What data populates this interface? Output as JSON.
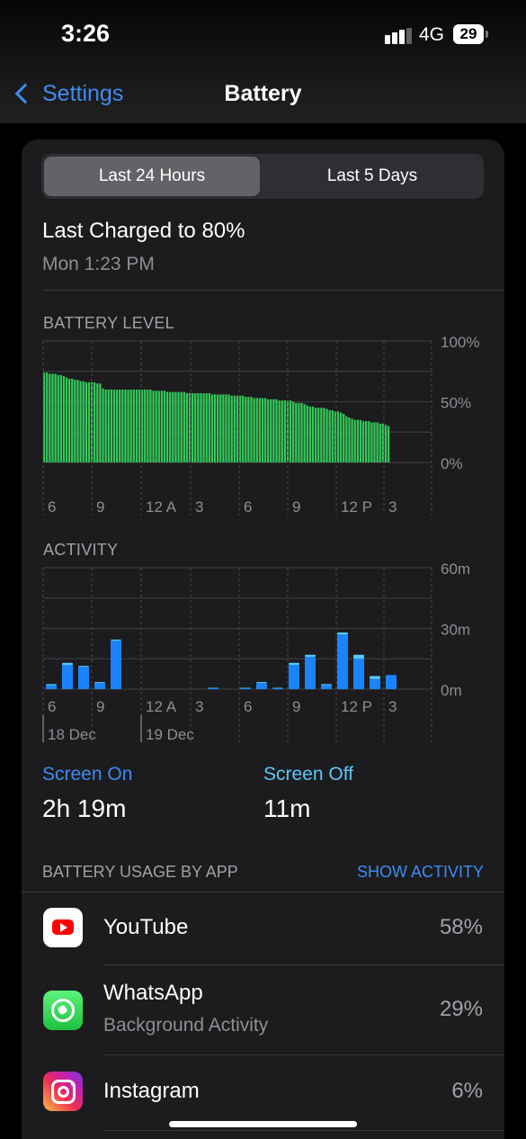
{
  "status_bar": {
    "time": "3:26",
    "network": "4G",
    "battery_percent": "29"
  },
  "nav": {
    "back_label": "Settings",
    "title": "Battery"
  },
  "segmented": {
    "options": [
      "Last 24 Hours",
      "Last 5 Days"
    ],
    "selected": "Last 24 Hours"
  },
  "last_charged": {
    "title": "Last Charged to 80%",
    "time": "Mon 1:23 PM"
  },
  "battery_level_label": "BATTERY LEVEL",
  "activity_label": "ACTIVITY",
  "chart_data": [
    {
      "type": "bar",
      "title": "BATTERY LEVEL",
      "color": "#34c759",
      "y_ticks": [
        "100%",
        "50%",
        "0%"
      ],
      "ylim": [
        0,
        100
      ],
      "x_ticks": [
        "6",
        "9",
        "12 A",
        "3",
        "6",
        "9",
        "12 P",
        "3"
      ],
      "values": [
        74,
        74,
        73,
        73,
        73,
        72,
        72,
        71,
        70,
        69,
        69,
        68,
        68,
        67,
        67,
        66,
        66,
        66,
        66,
        65,
        65,
        61,
        60,
        60,
        60,
        60,
        60,
        60,
        60,
        60,
        60,
        60,
        60,
        60,
        60,
        60,
        60,
        60,
        60,
        59,
        59,
        59,
        59,
        59,
        58,
        58,
        58,
        58,
        58,
        58,
        58,
        57,
        57,
        57,
        57,
        57,
        57,
        57,
        57,
        57,
        56,
        56,
        56,
        56,
        56,
        56,
        56,
        55,
        55,
        55,
        55,
        55,
        54,
        54,
        54,
        53,
        53,
        53,
        53,
        53,
        52,
        52,
        52,
        52,
        51,
        51,
        51,
        51,
        51,
        50,
        49,
        49,
        49,
        48,
        47,
        46,
        46,
        45,
        45,
        45,
        45,
        44,
        43,
        43,
        42,
        42,
        41,
        40,
        38,
        37,
        36,
        35,
        35,
        35,
        34,
        34,
        34,
        33,
        33,
        33,
        32,
        32,
        31,
        30
      ]
    },
    {
      "type": "bar",
      "title": "ACTIVITY",
      "y_ticks": [
        "60m",
        "30m",
        "0m"
      ],
      "ylim": [
        0,
        60
      ],
      "x_ticks": [
        "6",
        "9",
        "12 A",
        "3",
        "6",
        "9",
        "12 P",
        "3"
      ],
      "dates": [
        "18 Dec",
        "19 Dec"
      ],
      "hours": [
        "5",
        "6",
        "7",
        "8",
        "9",
        "10",
        "11",
        "12 A",
        "1",
        "2",
        "3",
        "4",
        "5",
        "6",
        "7",
        "8",
        "9",
        "10",
        "11",
        "12 P",
        "1",
        "2",
        "3"
      ],
      "series": [
        {
          "name": "Screen On",
          "color": "#1a84ff",
          "values": [
            2,
            12,
            11,
            3,
            24,
            0,
            0,
            0,
            0,
            0,
            0.5,
            0,
            0.5,
            3,
            0.5,
            12,
            16,
            2,
            27,
            15,
            5,
            7,
            0
          ]
        },
        {
          "name": "Screen Off",
          "color": "#5ac8fa",
          "values": [
            0.5,
            1,
            0.5,
            0.5,
            0.5,
            0,
            0,
            0,
            0,
            0,
            0.2,
            0,
            0.2,
            0.5,
            0.2,
            1,
            1,
            0.5,
            1,
            2,
            1.5,
            0,
            0
          ]
        }
      ]
    }
  ],
  "screen_on": {
    "label": "Screen On",
    "value": "2h 19m"
  },
  "screen_off": {
    "label": "Screen Off",
    "value": "11m"
  },
  "usage": {
    "header": "BATTERY USAGE BY APP",
    "show_activity": "SHOW ACTIVITY",
    "apps": [
      {
        "name": "YouTube",
        "subtitle": "",
        "percent": "58%",
        "icon": "youtube-icon"
      },
      {
        "name": "WhatsApp",
        "subtitle": "Background Activity",
        "percent": "29%",
        "icon": "whatsapp-icon"
      },
      {
        "name": "Instagram",
        "subtitle": "",
        "percent": "6%",
        "icon": "instagram-icon"
      }
    ]
  }
}
